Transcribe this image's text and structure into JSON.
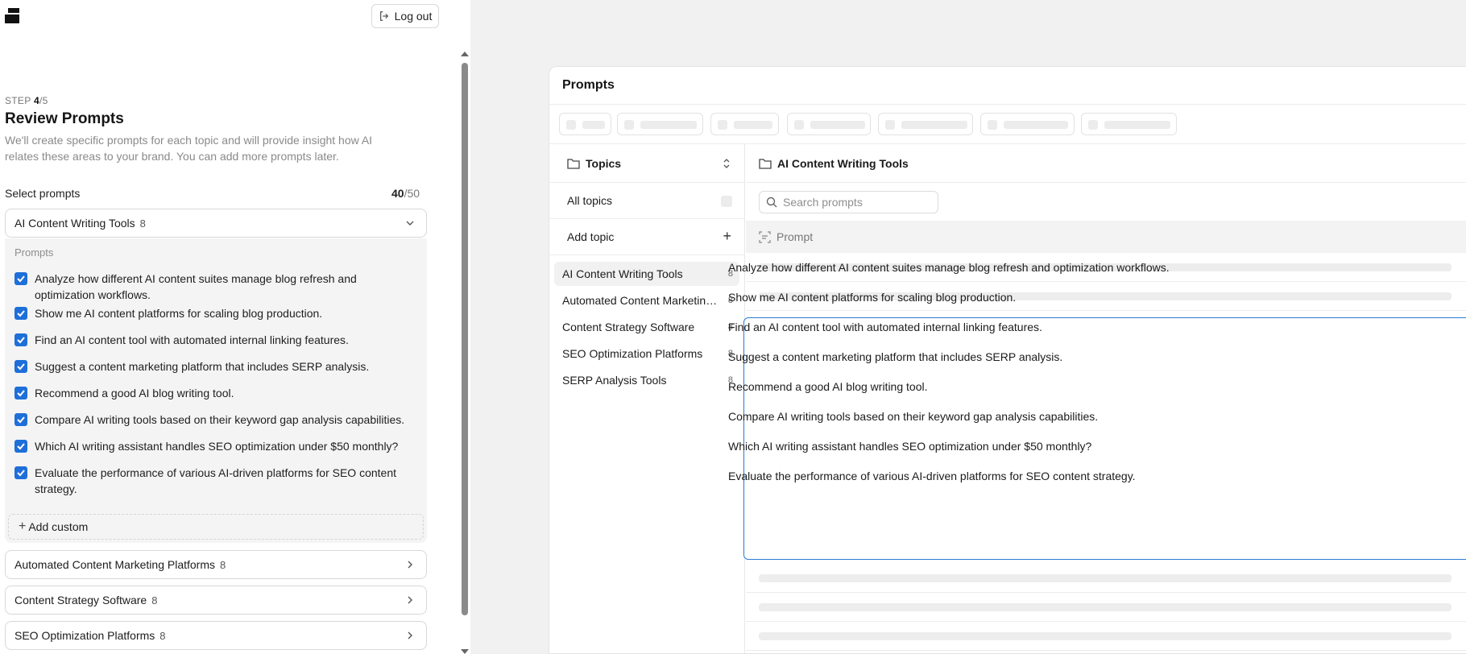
{
  "header": {
    "logout_label": "Log out"
  },
  "step": {
    "label": "STEP",
    "current": "4",
    "total": "/5"
  },
  "page": {
    "title": "Review Prompts",
    "description": "We'll create specific prompts for each topic and will provide insight how AI relates these areas to your brand. You can add more prompts later."
  },
  "select": {
    "label": "Select prompts",
    "count_selected": "40",
    "count_total": "/50"
  },
  "accordion": {
    "open_topic": {
      "name": "AI Content Writing Tools",
      "count": "8"
    },
    "prompts_label": "Prompts",
    "prompts": [
      "Analyze how different AI content suites manage blog refresh and optimization workflows.",
      "Show me AI content platforms for scaling blog production.",
      "Find an AI content tool with automated internal linking features.",
      "Suggest a content marketing platform that includes SERP analysis.",
      "Recommend a good AI blog writing tool.",
      "Compare AI writing tools based on their keyword gap analysis capabilities.",
      "Which AI writing assistant handles SEO optimization under $50 monthly?",
      "Evaluate the performance of various AI-driven platforms for SEO content strategy."
    ],
    "add_custom_label": "Add custom",
    "collapsed_topics": [
      {
        "name": "Automated Content Marketing Platforms",
        "count": "8"
      },
      {
        "name": "Content Strategy Software",
        "count": "8"
      },
      {
        "name": "SEO Optimization Platforms",
        "count": "8"
      }
    ]
  },
  "preview": {
    "title": "Prompts",
    "topics_header": "Topics",
    "all_topics_label": "All topics",
    "add_topic_label": "Add topic",
    "topics": [
      {
        "name": "AI Content Writing Tools",
        "count": "8"
      },
      {
        "name": "Automated Content Marketing Platforms",
        "count": "8"
      },
      {
        "name": "Content Strategy Software",
        "count": "8"
      },
      {
        "name": "SEO Optimization Platforms",
        "count": "8"
      },
      {
        "name": "SERP Analysis Tools",
        "count": "8"
      }
    ],
    "selected_topic": "AI Content Writing Tools",
    "search_placeholder": "Search prompts",
    "column_header": "Prompt",
    "prompts": [
      "Analyze how different AI content suites manage blog refresh and optimization workflows.",
      "Show me AI content platforms for scaling blog production.",
      "Find an AI content tool with automated internal linking features.",
      "Suggest a content marketing platform that includes SERP analysis.",
      "Recommend a good AI blog writing tool.",
      "Compare AI writing tools based on their keyword gap analysis capabilities.",
      "Which AI writing assistant handles SEO optimization under $50 monthly?",
      "Evaluate the performance of various AI-driven platforms for SEO content strategy."
    ]
  },
  "colors": {
    "accent": "#1e6fd9",
    "focus_border": "#2a7bd4",
    "canvas_bg": "#f1f1f1"
  }
}
